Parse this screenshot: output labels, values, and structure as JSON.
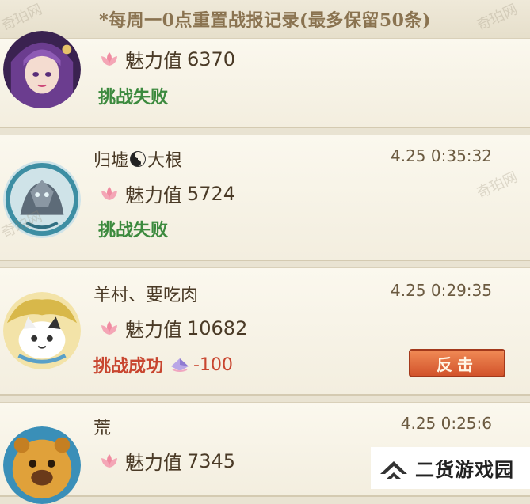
{
  "header": {
    "notice": "*每周一0点重置战报记录(最多保留50条)"
  },
  "charm_label": "魅力值",
  "records": [
    {
      "name": "",
      "time": "",
      "charm": "6370",
      "result": "挑战失败",
      "outcome": "fail"
    },
    {
      "name_left": "归墟",
      "name_right": "大根",
      "time": "4.25 0:35:32",
      "charm": "5724",
      "result": "挑战失败",
      "outcome": "fail"
    },
    {
      "name": "羊村、要吃肉",
      "time": "4.25 0:29:35",
      "charm": "10682",
      "result": "挑战成功",
      "outcome": "success",
      "points": "-100",
      "button": "反击"
    },
    {
      "name": "荒",
      "time": "4.25 0:25:6",
      "charm": "7345",
      "outcome": "unknown"
    }
  ],
  "watermarks": [
    "奇珀网",
    "奇珀网",
    "奇珀网",
    "奇珀网"
  ],
  "brand": {
    "name": "二货游戏园"
  },
  "colors": {
    "fail": "#3c8a3e",
    "success": "#c8452f",
    "button": "#e0693c",
    "header_text": "#8a7350"
  }
}
